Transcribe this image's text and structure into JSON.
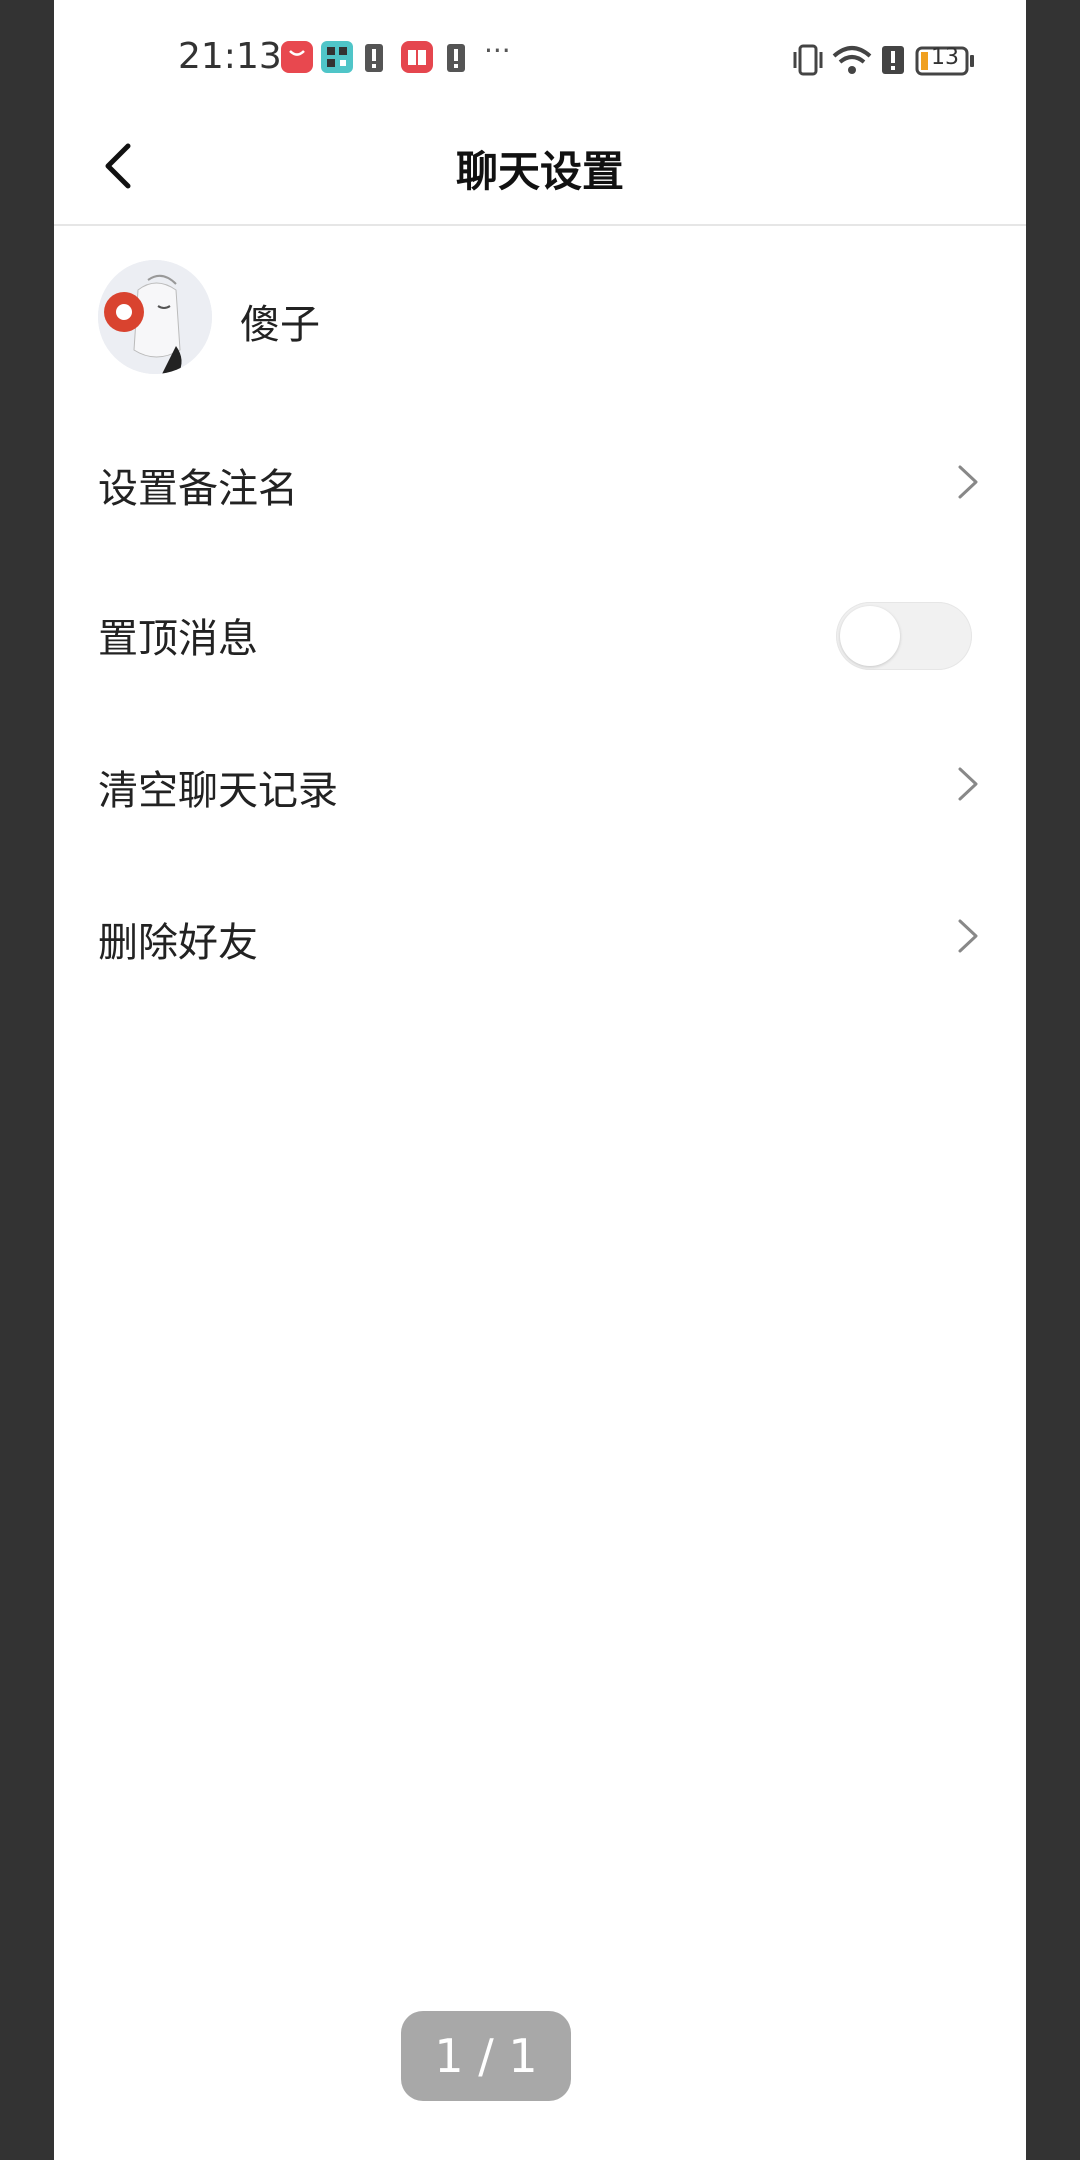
{
  "status_bar": {
    "time": "21:13",
    "battery": "13",
    "left_icons": [
      "app-gallery-icon",
      "qr-app-icon",
      "sim-alert-icon",
      "book-app-icon",
      "sim-alert-icon",
      "more-dots-icon"
    ],
    "right_icons": [
      "vibrate-icon",
      "wifi-icon",
      "sim-alert-icon",
      "battery-icon"
    ],
    "more": "···"
  },
  "header": {
    "title": "聊天设置",
    "back_icon": "chevron-left-icon"
  },
  "profile": {
    "name": "傻子"
  },
  "settings": {
    "items": [
      {
        "label": "设置备注名",
        "control": "chevron"
      },
      {
        "label": "置顶消息",
        "control": "toggle",
        "enabled": false
      },
      {
        "label": "清空聊天记录",
        "control": "chevron"
      },
      {
        "label": "删除好友",
        "control": "chevron"
      }
    ]
  },
  "pager": {
    "text": "1 / 1"
  },
  "colors": {
    "background": "#333333",
    "panel": "#ffffff",
    "toggle_off": "#f1f1f1",
    "pager_bg": "#a8a8a8"
  }
}
